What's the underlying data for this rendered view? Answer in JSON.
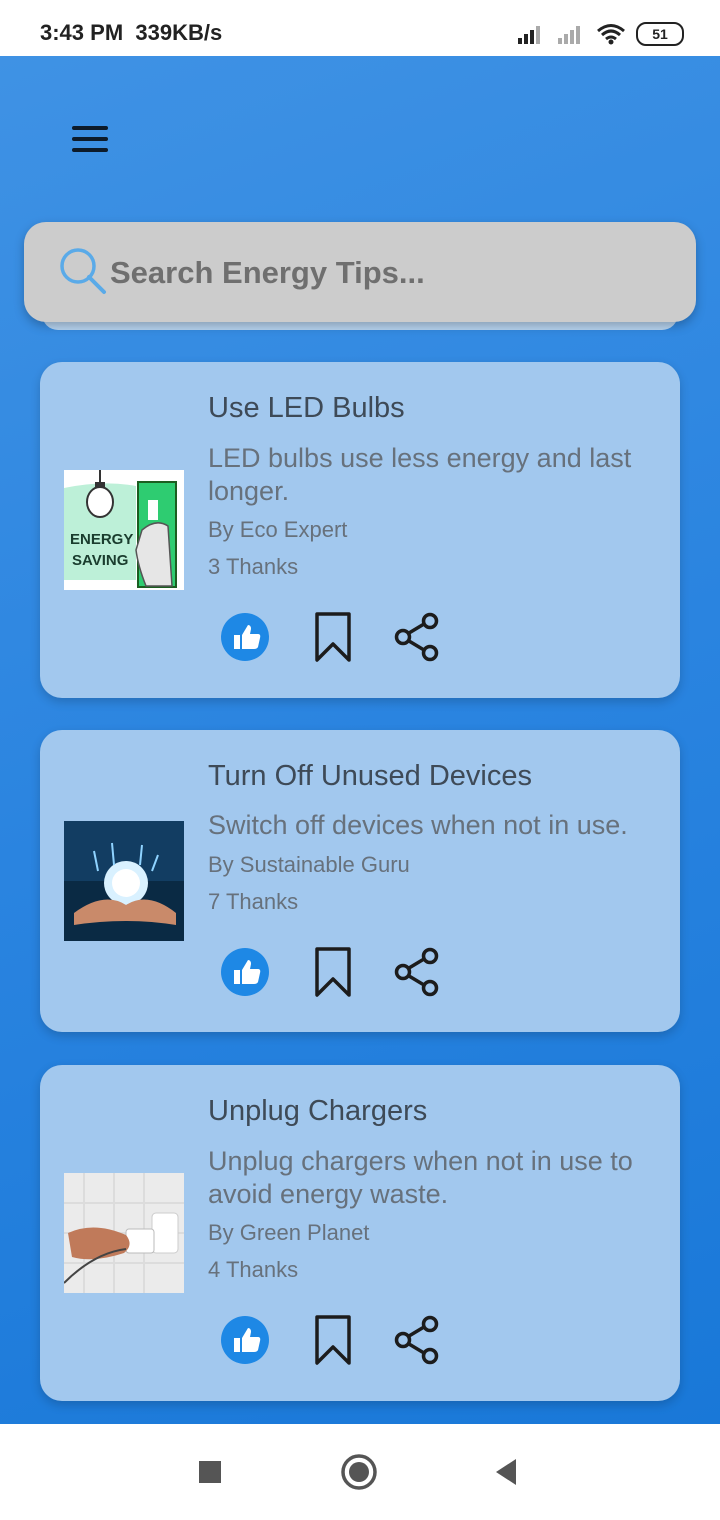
{
  "status_bar": {
    "time": "3:43 PM",
    "speed": "339KB/s",
    "battery": "51",
    "icons": [
      "signal-icon",
      "signal-icon",
      "wifi-icon",
      "battery-icon"
    ]
  },
  "search": {
    "placeholder": "Search Energy Tips..."
  },
  "tips": [
    {
      "title": "Use LED Bulbs",
      "description": "LED bulbs use less energy and last longer.",
      "author": "By Eco Expert",
      "thanks": "3 Thanks",
      "image_text_1": "ENERGY",
      "image_text_2": "SAVING"
    },
    {
      "title": "Turn Off Unused Devices",
      "description": "Switch off devices when not in use.",
      "author": "By Sustainable Guru",
      "thanks": "7 Thanks"
    },
    {
      "title": "Unplug Chargers",
      "description": "Unplug chargers when not in use to avoid energy waste.",
      "author": "By Green Planet",
      "thanks": "4 Thanks"
    }
  ],
  "actions": [
    "like-icon",
    "bookmark-icon",
    "share-icon"
  ],
  "colors": {
    "card": "#a2c8ee",
    "like": "#1e88e5",
    "background": "#2a84e0"
  },
  "nav": [
    "recents-icon",
    "home-icon",
    "back-icon"
  ]
}
